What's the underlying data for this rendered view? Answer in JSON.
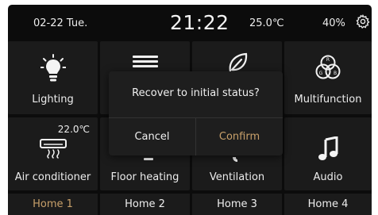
{
  "status_bar": {
    "date": "02-22  Tue.",
    "time": "21:22",
    "temperature": "25.0℃",
    "humidity": "40%",
    "settings_icon": "gear-icon"
  },
  "tiles": [
    {
      "label": "Lighting",
      "icon": "light-bulb-icon"
    },
    {
      "label": "",
      "icon": "curtain-icon"
    },
    {
      "label": "",
      "icon": "leaf-icon"
    },
    {
      "label": "Multifunction",
      "icon": "rgb-circles-icon"
    },
    {
      "label": "Air conditioner",
      "icon": "air-conditioner-icon",
      "value": "22.0℃"
    },
    {
      "label": "Floor heating",
      "icon": "floor-heating-icon"
    },
    {
      "label": "Ventilation",
      "icon": "fan-icon"
    },
    {
      "label": "Audio",
      "icon": "music-note-icon"
    }
  ],
  "tabs": [
    {
      "label": "Home 1",
      "active": true
    },
    {
      "label": "Home 2",
      "active": false
    },
    {
      "label": "Home 3",
      "active": false
    },
    {
      "label": "Home 4",
      "active": false
    }
  ],
  "dialog": {
    "message": "Recover to initial status?",
    "cancel_label": "Cancel",
    "confirm_label": "Confirm"
  },
  "colors": {
    "accent": "#c8a06a",
    "background": "#0c0c0c",
    "tile": "#1b1b1b"
  }
}
